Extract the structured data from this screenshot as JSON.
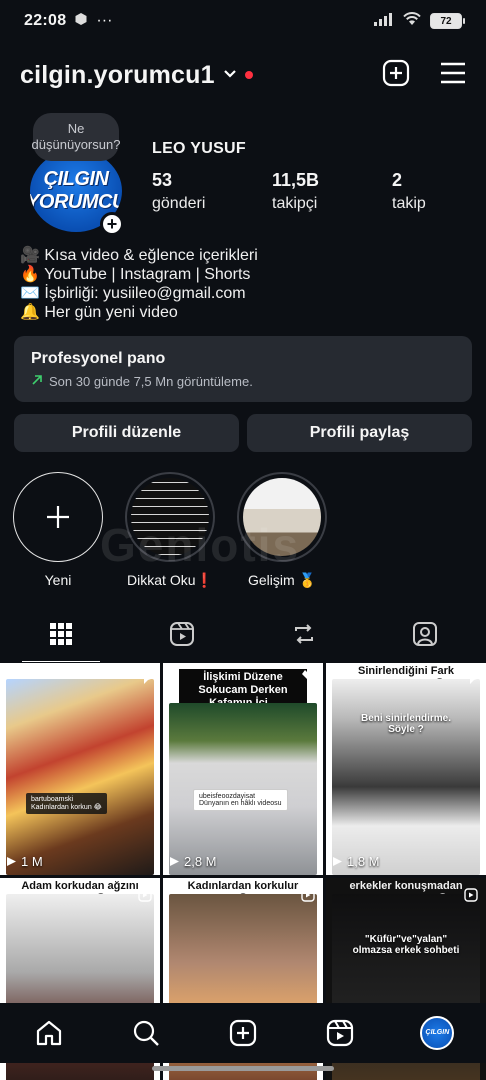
{
  "status_bar": {
    "time": "22:08",
    "extra_icons": "cube-icon",
    "dots": "···",
    "battery": "72"
  },
  "header": {
    "username": "cilgin.yorumcu1"
  },
  "note": {
    "text": "Ne düşünüyorsun?"
  },
  "avatar": {
    "logo_line1": "ÇILGIN",
    "logo_line2": "YORUMCU"
  },
  "profile": {
    "display_name": "LEO YUSUF",
    "stats": [
      {
        "value": "53",
        "label": "gönderi"
      },
      {
        "value": "11,5B",
        "label": "takipçi"
      },
      {
        "value": "2",
        "label": "takip"
      }
    ],
    "bio": [
      "🎥 Kısa video & eğlence içerikleri",
      "🔥 YouTube | Instagram | Shorts",
      "✉️ İşbirliği: yusiileo@gmail.com",
      "🔔 Her gün yeni video"
    ]
  },
  "dashboard": {
    "title": "Profesyonel pano",
    "subtitle": "Son 30 günde 7,5 Mn görüntüleme."
  },
  "buttons": {
    "edit": "Profili düzenle",
    "share": "Profili paylaş"
  },
  "highlights": [
    {
      "label": "Yeni"
    },
    {
      "label": "Dikkat Oku❗"
    },
    {
      "label": "Gelişim 🥇"
    }
  ],
  "watermark": "Geniotis",
  "grid": [
    {
      "caption": "",
      "views": "1 M",
      "overlay": "Kadınlardan korkun 😂",
      "overlay_user": "bartuboamski"
    },
    {
      "caption": "İlişkimi Düzene Sokucam Derken Kafamın İçi...",
      "views": "2,8 M",
      "overlay": "Dünyanın en hâklı videosu",
      "overlay_user": "ubeisfeoozdayisat"
    },
    {
      "caption": "Sinirlendiğini Fark Etmiyor Bile 😂",
      "views": "1,8 M",
      "overlay": "Beni sinirlendirme. Söyle ?"
    },
    {
      "caption": "Adam korkudan ağzını bağladı 😂",
      "views": "",
      "overlay": ""
    },
    {
      "caption": "Kadınlardan korkulur 😂",
      "views": "",
      "overlay": ""
    },
    {
      "caption": "erkekler konuşmadan da anlaşabilir 😂",
      "views": "",
      "overlay": "\"Küfür\"ve\"yalan\" olmazsa erkek sohbeti"
    }
  ]
}
